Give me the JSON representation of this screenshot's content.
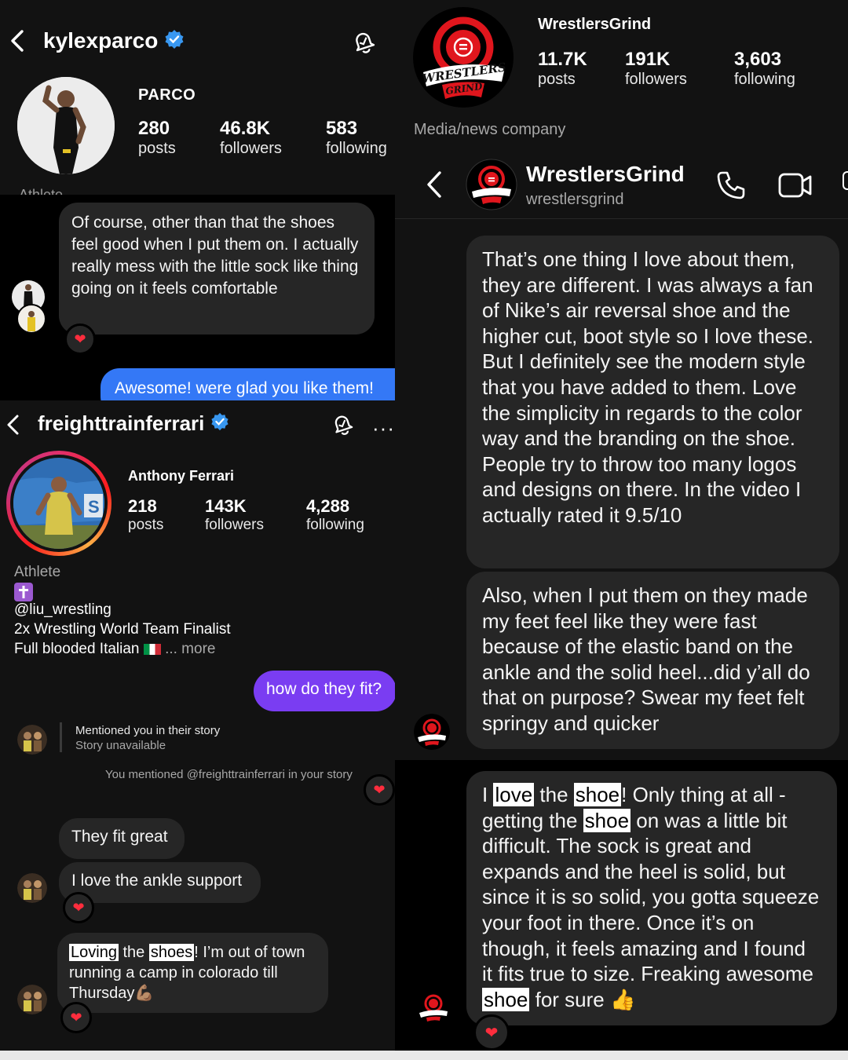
{
  "kyle": {
    "username": "kylexparco",
    "name": "PARCO",
    "stats": [
      {
        "num": "280",
        "label": "posts"
      },
      {
        "num": "46.8K",
        "label": "followers"
      },
      {
        "num": "583",
        "label": "following"
      }
    ],
    "category_cut": "Athlete",
    "message": "Of course, other than that the shoes feel good when I put them on. I actually really mess with the little sock like thing going on it feels comfortable",
    "reply": "Awesome! were glad you like them!"
  },
  "wg_profile": {
    "name": "WrestlersGrind",
    "stats": [
      {
        "num": "11.7K",
        "label": "posts"
      },
      {
        "num": "191K",
        "label": "followers"
      },
      {
        "num": "3,603",
        "label": "following"
      }
    ],
    "category": "Media/news company",
    "logo_text_1": "WRESTLERS",
    "logo_text_2": "GRIND"
  },
  "wg_chat": {
    "name": "WrestlersGrind",
    "handle": "wrestlersgrind",
    "msg1": "That’s one thing I love about them, they are different. I was always a fan of Nike’s air reversal shoe and the higher cut, boot style so I love these. But I definitely see the modern style that you have added to them. Love the simplicity in regards to the color way and the branding on the shoe. People try to throw too many logos and designs on there. In the video I actually rated it 9.5/10",
    "msg2": "Also, when I put them on they made my feet feel like they were fast because of the elastic band on the ankle and the solid heel...did y’all do that on purpose? Swear my feet felt springy and quicker",
    "msg3": {
      "p1": "I ",
      "h1": "love",
      "p2": " the ",
      "h2": "shoe",
      "p3": "! Only thing at all - getting the ",
      "h3": "shoe",
      "p4": " on was a little bit difficult. The sock is great and expands and the heel is solid, but since it is so solid, you gotta squeeze your foot in there. Once it’s on though, it feels amazing and I found it fits true to size. Freaking awesome ",
      "h4": "shoe",
      "p5": " for sure ",
      "emoji": "👍"
    }
  },
  "anthony": {
    "username": "freighttrainferrari",
    "name": "Anthony Ferrari",
    "stats": [
      {
        "num": "218",
        "label": "posts"
      },
      {
        "num": "143K",
        "label": "followers"
      },
      {
        "num": "4,288",
        "label": "following"
      }
    ],
    "category": "Athlete",
    "cross": "✝️",
    "bio1": "@liu_wrestling",
    "bio2": "2x Wrestling World Team Finalist",
    "bio3": "Full blooded Italian",
    "flag": "🇮🇹",
    "more": "... more",
    "sent": "how do they fit?",
    "story_line1": "Mentioned you in their story",
    "story_line2": "Story unavailable",
    "mention_note": "You mentioned @freighttrainferrari in your story",
    "msg1": "They fit great",
    "msg2": "I love the ankle support",
    "msg3": {
      "h1": "Loving",
      "p1": " the ",
      "h2": "shoes",
      "p2": "! I’m out of town running a camp in colorado till Thursday",
      "emoji": "💪🏽"
    }
  },
  "colors": {
    "blue_bubble": "#3478f6",
    "purple_bubble": "#7a3df2",
    "verified": "#3897f0",
    "wg_red": "#e0161d",
    "dark_panel": "#121212",
    "bubble_gray": "#262626"
  },
  "icons": [
    "chevron-left-icon",
    "bell-icon",
    "verified-badge-icon",
    "phone-icon",
    "video-icon",
    "more-icon",
    "heart-icon",
    "cross-icon"
  ]
}
